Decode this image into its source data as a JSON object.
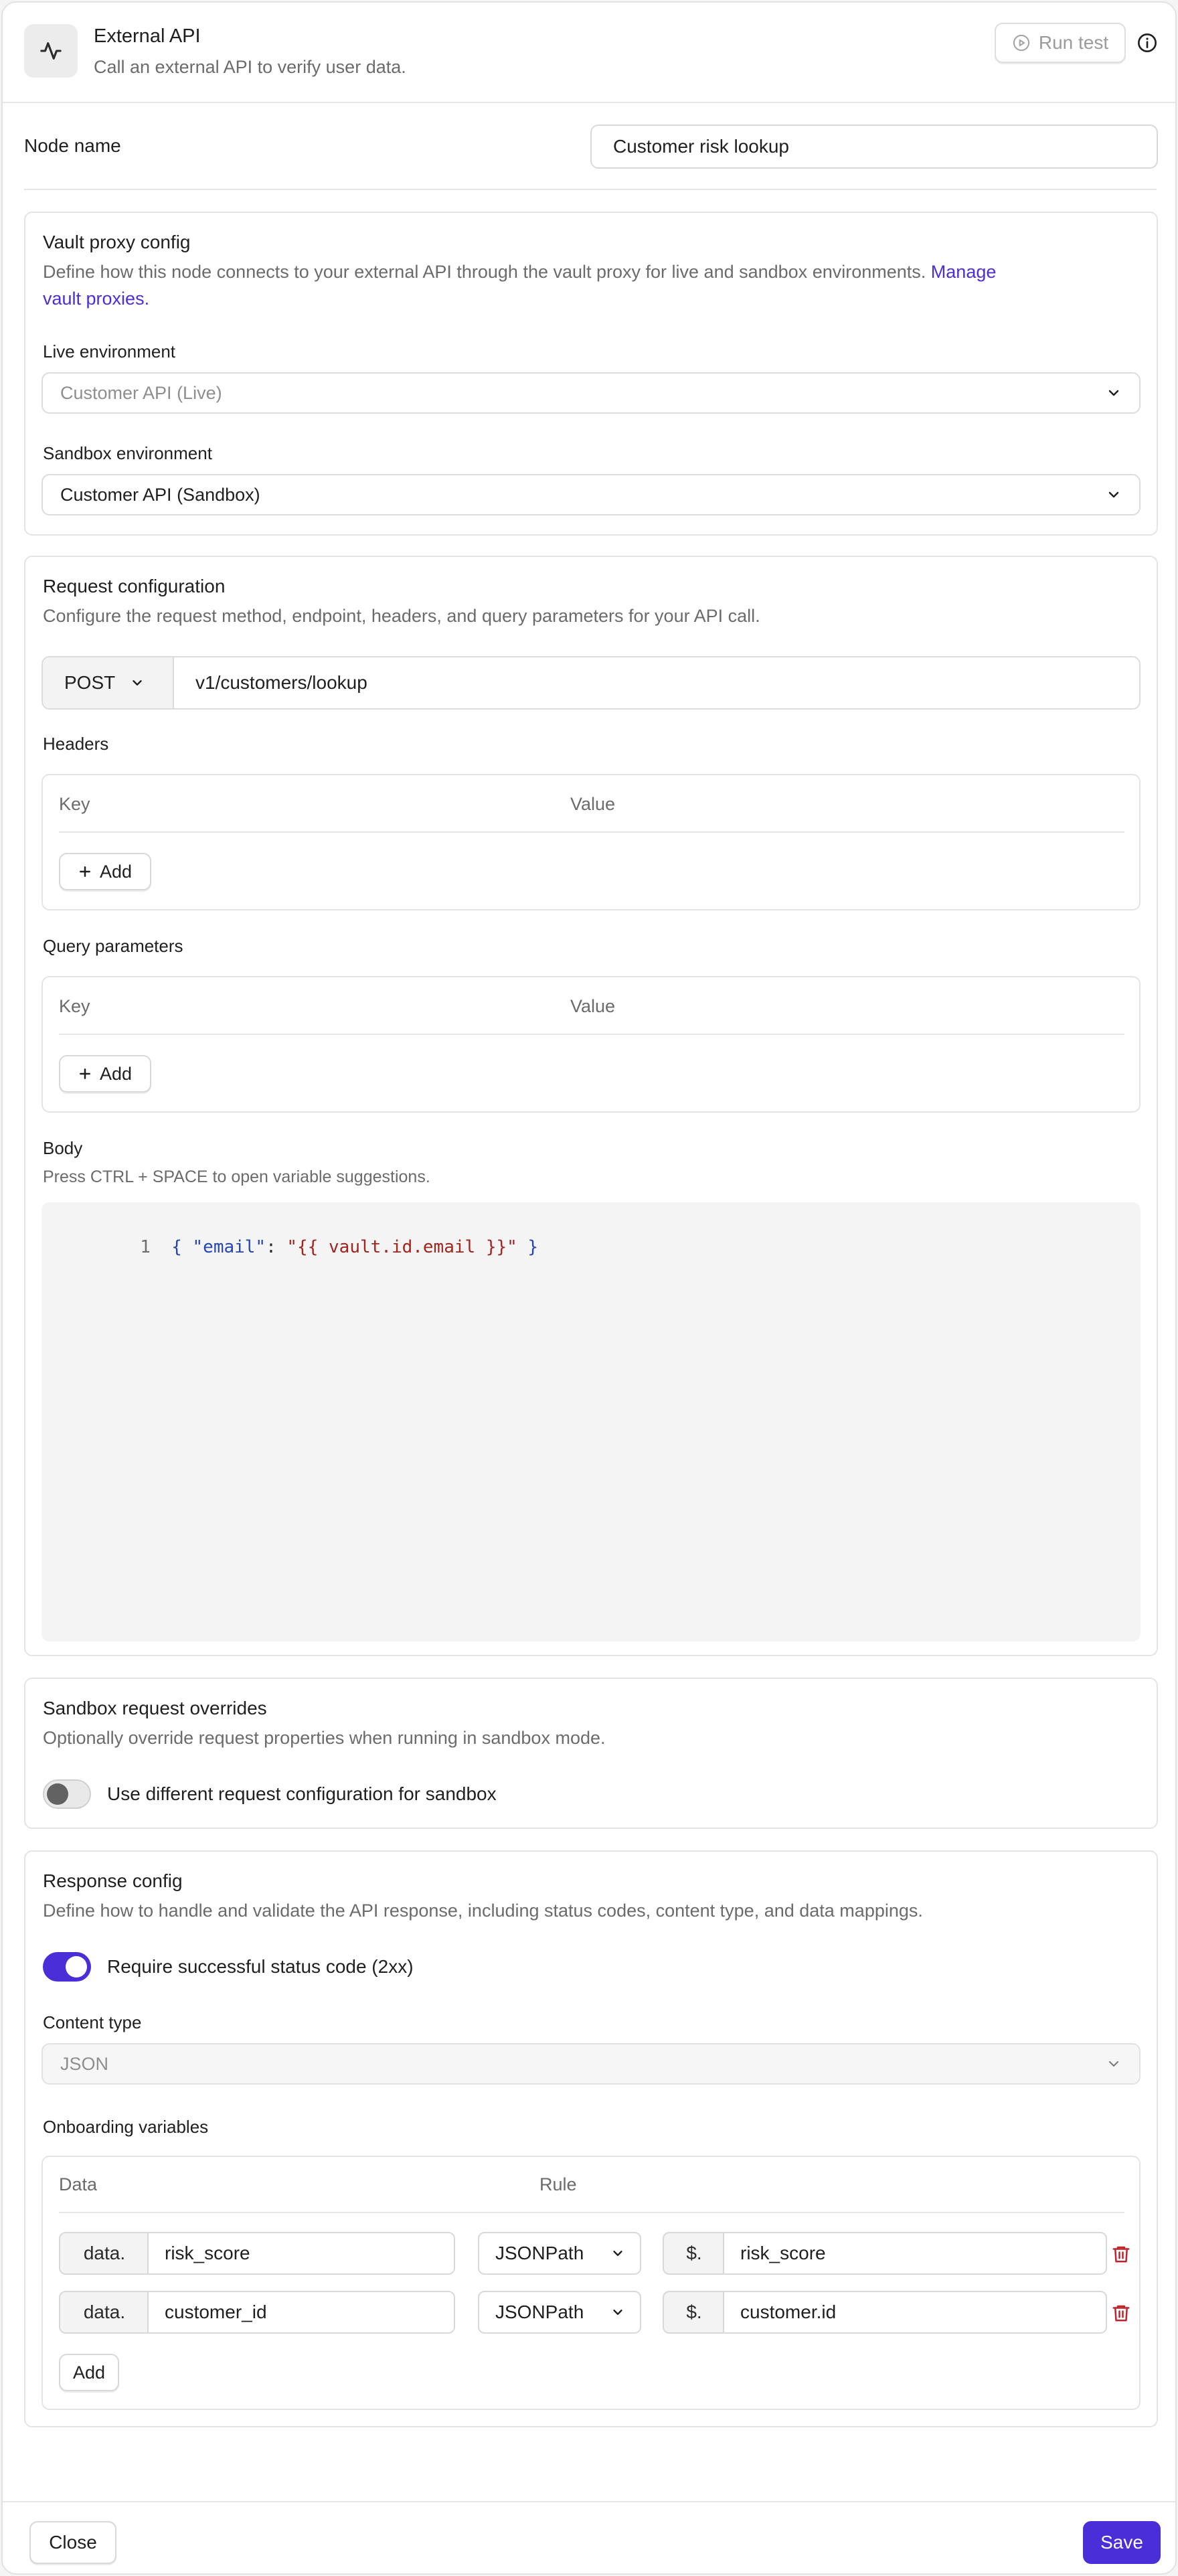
{
  "header": {
    "title": "External API",
    "subtitle": "Call an external API to verify user data.",
    "run_test_label": "Run test",
    "icon": "activity-icon",
    "info_icon": "info-icon"
  },
  "node_name": {
    "label": "Node name",
    "value": "Customer risk lookup"
  },
  "vault": {
    "title": "Vault proxy config",
    "description": "Define how this node connects to your external API through the vault proxy for live and sandbox environments.",
    "link_line1": "Manage",
    "link_line2": "vault proxies.",
    "live_label": "Live environment",
    "live_placeholder": "Customer API (Live)",
    "sandbox_label": "Sandbox environment",
    "sandbox_value": "Customer API (Sandbox)"
  },
  "request": {
    "title": "Request configuration",
    "description": "Configure the request method, endpoint, headers, and query parameters for your API call.",
    "method": "POST",
    "endpoint": "v1/customers/lookup",
    "headers_label": "Headers",
    "query_label": "Query parameters",
    "key_col": "Key",
    "value_col": "Value",
    "add_label": "Add",
    "body_label": "Body",
    "body_hint": "Press CTRL + SPACE to open variable suggestions.",
    "code_line_no": "1",
    "code_open": "{ ",
    "code_key": "\"email\"",
    "code_colon": ": ",
    "code_value": "\"{{ vault.id.email }}\"",
    "code_close": " }"
  },
  "overrides": {
    "title": "Sandbox request overrides",
    "description": "Optionally override request properties when running in sandbox mode.",
    "toggle_label": "Use different request configuration for sandbox",
    "toggle_on": false
  },
  "response": {
    "title": "Response config",
    "description": "Define how to handle and validate the API response, including status codes, content type, and data mappings.",
    "toggle_label": "Require successful status code (2xx)",
    "toggle_on": true,
    "content_type_label": "Content type",
    "content_type_value": "JSON",
    "onboarding_label": "Onboarding variables",
    "data_col": "Data",
    "rule_col": "Rule",
    "rows": [
      {
        "prefix": "data.",
        "field": "risk_score",
        "rule": "JSONPath",
        "path_prefix": "$.",
        "path": "risk_score"
      },
      {
        "prefix": "data.",
        "field": "customer_id",
        "rule": "JSONPath",
        "path_prefix": "$.",
        "path": "customer.id"
      }
    ],
    "add_label": "Add"
  },
  "footer": {
    "close_label": "Close",
    "save_label": "Save"
  },
  "colors": {
    "accent": "#4a2ed8",
    "danger": "#c0242a",
    "code_key": "#2345b8",
    "code_string": "#a2241c",
    "code_bg": "#f4f4f4"
  }
}
